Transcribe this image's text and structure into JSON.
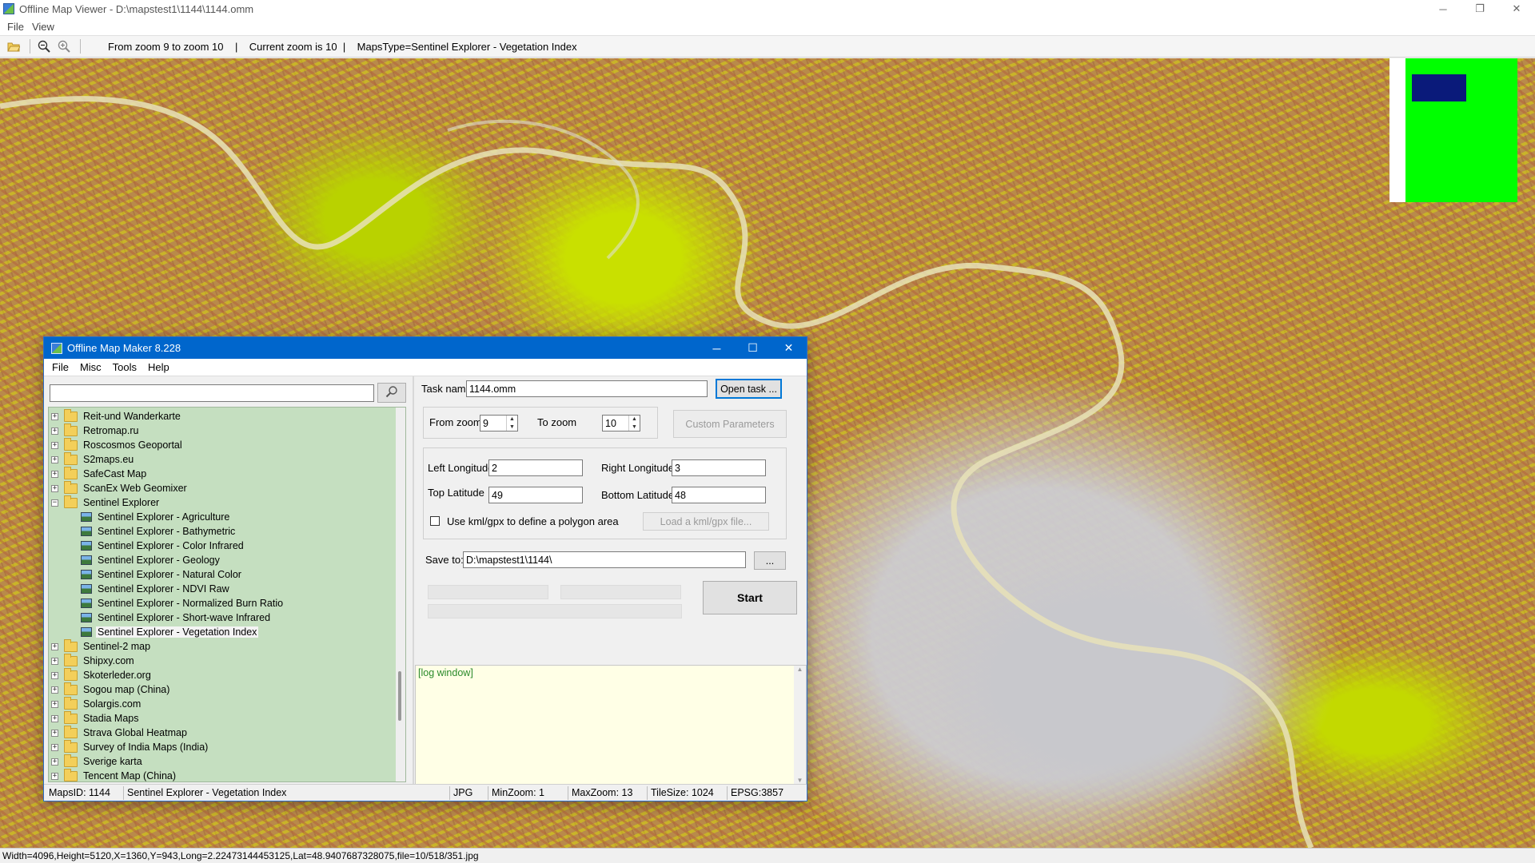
{
  "window": {
    "title": "Offline Map Viewer - D:\\mapstest1\\1144\\1144.omm",
    "controls": {
      "minimize": "─",
      "restore": "❐",
      "close": "✕"
    }
  },
  "menu": {
    "file": "File",
    "view": "View"
  },
  "toolbar": {
    "icons": [
      "open-folder-icon",
      "zoom-out-icon",
      "zoom-in-icon"
    ],
    "info": "From zoom 9 to zoom 10    |    Current zoom is 10  |    MapsType=Sentinel Explorer - Vegetation Index"
  },
  "status_bar": "Width=4096,Height=5120,X=1360,Y=943,Long=2.22473144453125,Lat=48.9407687328075,file=10/518/351.jpg",
  "dialog": {
    "title": "Offline Map Maker 8.228",
    "controls": {
      "minimize": "─",
      "maximize": "☐",
      "close": "✕"
    },
    "menu": {
      "file": "File",
      "misc": "Misc",
      "tools": "Tools",
      "help": "Help"
    },
    "search": {
      "value": "",
      "button_icon": "magnifier-icon"
    },
    "tree": [
      {
        "label": "Reit-und Wanderkarte",
        "type": "folder",
        "expanded": false
      },
      {
        "label": "Retromap.ru",
        "type": "folder",
        "expanded": false
      },
      {
        "label": "Roscosmos Geoportal",
        "type": "folder",
        "expanded": false
      },
      {
        "label": "S2maps.eu",
        "type": "folder",
        "expanded": false
      },
      {
        "label": "SafeCast Map",
        "type": "folder",
        "expanded": false
      },
      {
        "label": "ScanEx Web Geomixer",
        "type": "folder",
        "expanded": false
      },
      {
        "label": "Sentinel Explorer",
        "type": "folder",
        "expanded": true
      },
      {
        "label": "Sentinel Explorer - Agriculture",
        "type": "map"
      },
      {
        "label": "Sentinel Explorer - Bathymetric",
        "type": "map"
      },
      {
        "label": "Sentinel Explorer - Color Infrared",
        "type": "map"
      },
      {
        "label": "Sentinel Explorer - Geology",
        "type": "map"
      },
      {
        "label": "Sentinel Explorer - Natural Color",
        "type": "map"
      },
      {
        "label": "Sentinel Explorer - NDVI Raw",
        "type": "map"
      },
      {
        "label": "Sentinel Explorer - Normalized Burn Ratio",
        "type": "map"
      },
      {
        "label": "Sentinel Explorer - Short-wave Infrared",
        "type": "map"
      },
      {
        "label": "Sentinel Explorer - Vegetation Index",
        "type": "map",
        "selected": true
      },
      {
        "label": "Sentinel-2 map",
        "type": "folder",
        "expanded": false
      },
      {
        "label": "Shipxy.com",
        "type": "folder",
        "expanded": false
      },
      {
        "label": "Skoterleder.org",
        "type": "folder",
        "expanded": false
      },
      {
        "label": "Sogou map (China)",
        "type": "folder",
        "expanded": false
      },
      {
        "label": "Solargis.com",
        "type": "folder",
        "expanded": false
      },
      {
        "label": "Stadia Maps",
        "type": "folder",
        "expanded": false
      },
      {
        "label": "Strava Global Heatmap",
        "type": "folder",
        "expanded": false
      },
      {
        "label": "Survey of India Maps (India)",
        "type": "folder",
        "expanded": false
      },
      {
        "label": "Sverige karta",
        "type": "folder",
        "expanded": false
      },
      {
        "label": "Tencent Map (China)",
        "type": "folder",
        "expanded": false
      }
    ],
    "form": {
      "task_name_label": "Task name",
      "task_name_value": "1144.omm",
      "open_task": "Open task ...",
      "from_zoom_label": "From zoom",
      "from_zoom_value": "9",
      "to_zoom_label": "To zoom",
      "to_zoom_value": "10",
      "custom_params": "Custom Parameters",
      "left_lon_label": "Left Longitude",
      "left_lon_value": "2",
      "right_lon_label": "Right Longitude",
      "right_lon_value": "3",
      "top_lat_label": "Top Latitude",
      "top_lat_value": "49",
      "bottom_lat_label": "Bottom Latitude",
      "bottom_lat_value": "48",
      "kml_checkbox_label": "Use kml/gpx to define a polygon area",
      "kml_checked": false,
      "load_kml": "Load a kml/gpx file...",
      "save_to_label": "Save to:",
      "save_to_value": "D:\\mapstest1\\1144\\",
      "browse": "...",
      "start": "Start"
    },
    "log": "[log window]",
    "status": {
      "maps_id": "MapsID: 1144",
      "map_name": "Sentinel Explorer - Vegetation Index",
      "format": "JPG",
      "min_zoom": "MinZoom: 1",
      "max_zoom": "MaxZoom: 13",
      "tile_size": "TileSize: 1024",
      "epsg": "EPSG:3857"
    }
  },
  "colors": {
    "dialog_title_bg": "#0066cc",
    "tree_bg": "#c5dfc0",
    "log_bg": "#ffffe6",
    "log_text": "#2a8a2a",
    "minimap_green": "#00ff00",
    "minimap_view": "#0a1a7a"
  }
}
